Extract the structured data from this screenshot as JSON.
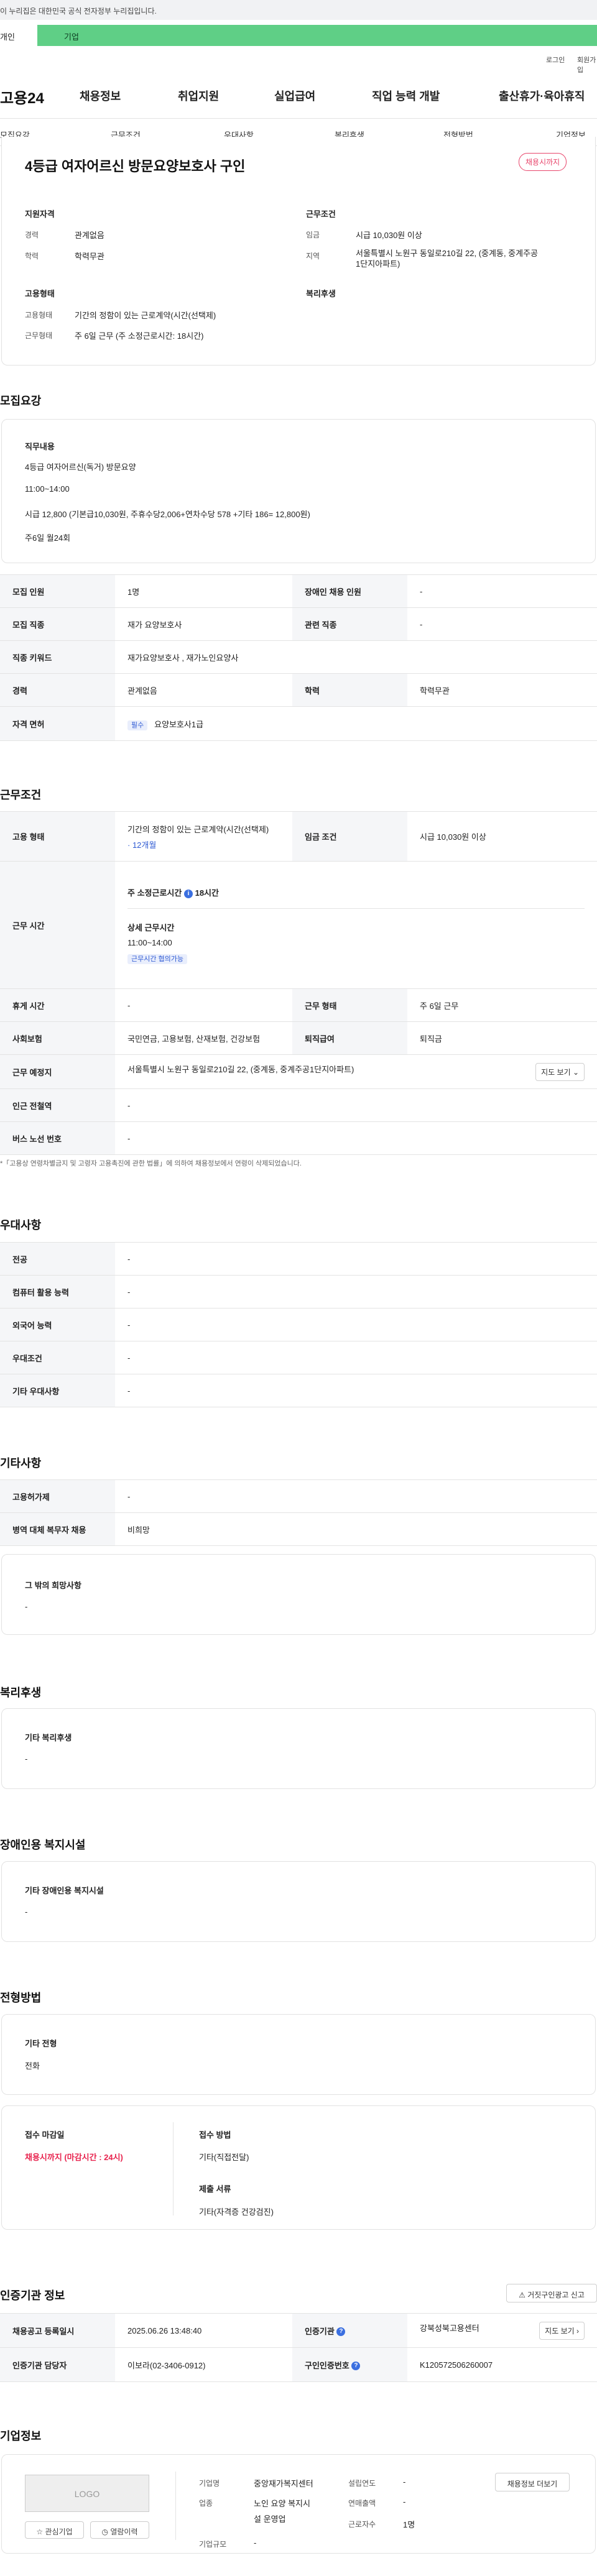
{
  "gov_banner": "이 누리집은 대한민국 공식 전자정부 누리집입니다.",
  "tabs": {
    "individual": "개인",
    "business": "기업"
  },
  "util": {
    "login": "로그인",
    "join": "회원가입"
  },
  "logo": "고용24",
  "gnb": [
    "채용정보",
    "취업지원",
    "실업급여",
    "직업 능력 개발",
    "출산휴가·육아휴직"
  ],
  "subnav": [
    "모집요강",
    "근무조건",
    "우대사항",
    "복리후생",
    "전형방법",
    "기업정보"
  ],
  "summary": {
    "title": "4등급 여자어르신 방문요양보호사 구인",
    "status": "채용시까지",
    "qual_title": "지원자격",
    "career_k": "경력",
    "career_v": "관계없음",
    "edu_k": "학력",
    "edu_v": "학력무관",
    "emp_title": "고용형태",
    "emptype_k": "고용형태",
    "emptype_v": "기간의 정함이 있는 근로계약(시간(선택제)",
    "work_k": "근무형태",
    "work_v": "주 6일 근무 (주 소정근로시간: 18시간)",
    "cond_title": "근무조건",
    "wage_k": "임금",
    "wage_v": "시급 10,030원 이상",
    "area_k": "지역",
    "area_v1": "서울특별시 노원구 동일로210길 22, (중계동, 중계주공",
    "area_v2": "1단지아파트)",
    "welfare_title": "복리후생"
  },
  "recruit": {
    "heading": "모집요강",
    "duty_title": "직무내용",
    "duty_lines": [
      "4등급 여자어르신(독거) 방문요양",
      "11:00~14:00",
      "시급 12,800 (기본급10,030원, 주휴수당2,006+연차수당 578 +기타 186= 12,800원)",
      "주6일 월24회"
    ],
    "rows": {
      "count_k": "모집 인원",
      "count_v": "1명",
      "disabled_k": "장애인 채용 인원",
      "disabled_v": "-",
      "job_k": "모집 직종",
      "job_v": "재가 요양보호사",
      "related_k": "관련 직종",
      "related_v": "-",
      "keyword_k": "직종 키워드",
      "keyword_v": "재가요양보호사 , 재가노인요양사",
      "career_k": "경력",
      "career_v": "관계없음",
      "edu_k": "학력",
      "edu_v": "학력무관",
      "license_k": "자격 면허",
      "license_chip": "필수",
      "license_v": "요양보호사1급"
    }
  },
  "conditions": {
    "heading": "근무조건",
    "emp_k": "고용 형태",
    "emp_v": "기간의 정함이 있는 근로계약(시간(선택제)",
    "emp_period": "· 12개월",
    "wage_k": "임금 조건",
    "wage_v": "시급 10,030원 이상",
    "time_k": "근무 시간",
    "weekly_label": "주 소정근로시간",
    "weekly_v": "18시간",
    "detail_label": "상세 근무시간",
    "detail_v": "11:00~14:00",
    "detail_chip": "근무시간 협의가능",
    "rest_k": "휴게 시간",
    "rest_v": "-",
    "worktype_k": "근무 형태",
    "worktype_v": "주 6일 근무",
    "insurance_k": "사회보험",
    "insurance_v": "국민연금, 고용보험, 산재보험, 건강보험",
    "severance_k": "퇴직급여",
    "severance_v": "퇴직금",
    "place_k": "근무 예정지",
    "place_v": "서울특별시 노원구 동일로210길 22, (중계동, 중계주공1단지아파트)",
    "map_btn": "지도 보기",
    "subway_k": "인근 전철역",
    "subway_v": "-",
    "bus_k": "버스 노선 번호",
    "bus_v": "-",
    "note": "*「고용상 연령차별금지 및 고령자 고용촉진에 관한 법률」에 의하여 채용정보에서 연령이 삭제되었습니다."
  },
  "preference": {
    "heading": "우대사항",
    "major_k": "전공",
    "major_v": "-",
    "computer_k": "컴퓨터 활용 능력",
    "computer_v": "-",
    "language_k": "외국어 능력",
    "language_v": "-",
    "cond_k": "우대조건",
    "cond_v": "-",
    "etc_k": "기타 우대사항",
    "etc_v": "-"
  },
  "other": {
    "heading": "기타사항",
    "notify_k": "고용허가제",
    "notify_v": "-",
    "military_k": "병역 대체 복무자 채용",
    "military_v": "비희망",
    "wish_title": "그 밖의 희망사항",
    "wish_v": "-"
  },
  "welfare": {
    "heading": "복리후생",
    "title": "기타 복리후생",
    "v": "-"
  },
  "disabled_fac": {
    "heading": "장애인용 복지시설",
    "title": "기타 장애인용 복지시설",
    "v": "-"
  },
  "selection": {
    "heading": "전형방법",
    "etc_title": "기타 전형",
    "etc_v": "전화",
    "deadline_title": "접수 마감일",
    "deadline_v": "채용시까지 (마감시간 : 24시)",
    "method_title": "접수 방법",
    "method_v": "기타(직접전달)",
    "docs_title": "제출 서류",
    "docs_v": "기타(자격증 건강검진)"
  },
  "certification": {
    "heading": "인증기관 정보",
    "report_btn": "거짓구인광고 신고",
    "reg_k": "채용공고 등록일시",
    "reg_v": "2025.06.26 13:48:40",
    "org_k": "인증기관",
    "org_v": "강북성북고용센터",
    "map_btn": "지도 보기",
    "manager_k": "인증기관 담당자",
    "manager_v": "이보라(02-3406-0912)",
    "num_k": "구인인증번호",
    "num_v": "K120572506260007"
  },
  "company": {
    "heading": "기업정보",
    "logo_text": "LOGO",
    "fav_btn": "관심기업",
    "search_btn": "열람이력",
    "name_k": "기업명",
    "name_v": "중앙재가복지센터",
    "industry_k": "업종",
    "industry_v1": "노인 요양 복지시",
    "industry_v2": "설 운영업",
    "size_k": "기업규모",
    "size_v": "-",
    "founded_k": "설립연도",
    "founded_v": "-",
    "sales_k": "연매출액",
    "sales_v": "-",
    "staff_k": "근로자수",
    "staff_v": "1명",
    "jobs_btn": "채용정보 더보기"
  }
}
